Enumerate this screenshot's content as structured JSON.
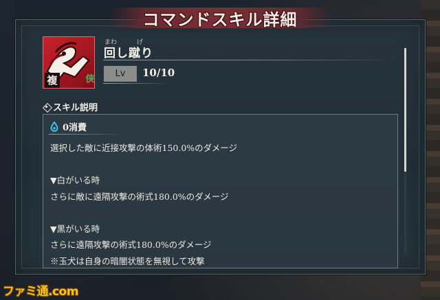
{
  "window": {
    "title": "コマンドスキル詳細"
  },
  "skill": {
    "name": "回し蹴り",
    "ruby": [
      "まわ",
      "げ"
    ],
    "icon": {
      "name": "kick-skill-icon",
      "badge_top": "侠",
      "badge_bottom": "複",
      "color": "#c6222b"
    },
    "level_label": "Lv",
    "level_value": "10/10"
  },
  "description": {
    "heading": "スキル説明",
    "cost": "0消費",
    "cost_icon": "drop-icon",
    "lines": [
      "選択した敵に近接攻撃の体術150.0%のダメージ",
      "",
      "▼白がいる時",
      "さらに敵に遠隔攻撃の術式180.0%のダメージ",
      "",
      "▼黒がいる時",
      "さらに遠隔攻撃の術式180.0%のダメージ",
      "※玉犬は自身の暗闇状態を無視して攻撃"
    ]
  },
  "watermark": "ファミ通.com",
  "colors": {
    "panel": "#223039",
    "title_banner": "#7a2f33",
    "accent_cyan": "#39c6e8"
  }
}
